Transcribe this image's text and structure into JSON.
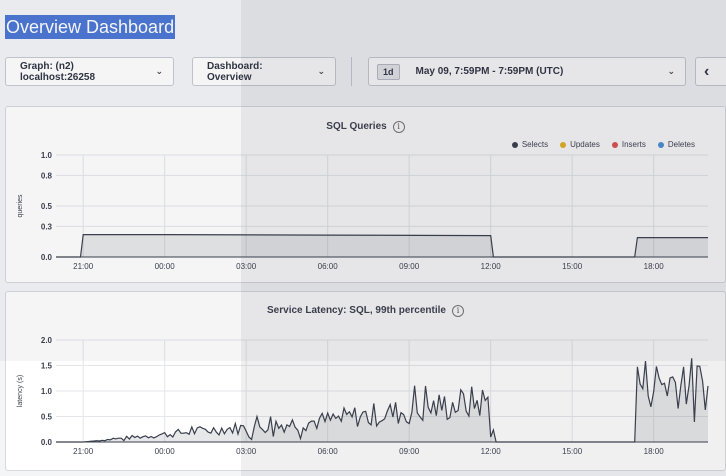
{
  "page": {
    "title": "Overview Dashboard"
  },
  "toolbar": {
    "graph_label": "Graph: (n2) localhost:26258",
    "dashboard_label": "Dashboard: Overview",
    "time_badge": "1d",
    "time_range": "May 09, 7:59PM - 7:59PM (UTC)",
    "prev_icon": "chevron-left-icon"
  },
  "charts": {
    "sql_queries": {
      "title": "SQL Queries",
      "ylabel": "queries",
      "yticks": [
        "1.0",
        "0.8",
        "0.5",
        "0.3",
        "0.0"
      ],
      "xticks": [
        "21:00",
        "00:00",
        "03:00",
        "06:00",
        "09:00",
        "12:00",
        "15:00",
        "18:00"
      ],
      "legend": [
        {
          "name": "Selects",
          "color": "#3a3f4d"
        },
        {
          "name": "Updates",
          "color": "#e6b422"
        },
        {
          "name": "Inserts",
          "color": "#e05252"
        },
        {
          "name": "Deletes",
          "color": "#4a90d9"
        }
      ]
    },
    "service_latency": {
      "title": "Service Latency: SQL, 99th percentile",
      "ylabel": "latency (s)",
      "yticks": [
        "2.0",
        "1.5",
        "1.0",
        "0.5",
        "0.0"
      ],
      "xticks": [
        "21:00",
        "00:00",
        "03:00",
        "06:00",
        "09:00",
        "12:00",
        "15:00",
        "18:00"
      ]
    }
  },
  "chart_data": [
    {
      "type": "area",
      "title": "SQL Queries",
      "ylabel": "queries",
      "ylim": [
        0,
        1.0
      ],
      "x_ticks": [
        "21:00",
        "00:00",
        "03:00",
        "06:00",
        "09:00",
        "12:00",
        "15:00",
        "18:00"
      ],
      "series": [
        {
          "name": "Selects",
          "x": [
            20.0,
            20.9,
            21.0,
            24.0,
            30.0,
            36.0,
            12.1,
            12.3,
            17.3,
            17.4,
            17.6,
            20.0
          ],
          "x_note_hours": "time of day",
          "points_hours": [
            0,
            0.9,
            1.0,
            4.0,
            10.0,
            16.0,
            16.1,
            16.3,
            21.3,
            21.4,
            21.6,
            24.0
          ],
          "values": [
            0,
            0,
            0.22,
            0.22,
            0.215,
            0.21,
            0.0,
            0.0,
            0.0,
            0.19,
            0.19,
            0.19
          ]
        },
        {
          "name": "Updates",
          "values": []
        },
        {
          "name": "Inserts",
          "values": []
        },
        {
          "name": "Deletes",
          "values": []
        }
      ]
    },
    {
      "type": "area",
      "title": "Service Latency: SQL, 99th percentile",
      "ylabel": "latency (s)",
      "ylim": [
        0,
        2.0
      ],
      "x_ticks": [
        "21:00",
        "00:00",
        "03:00",
        "06:00",
        "09:00",
        "12:00",
        "15:00",
        "18:00"
      ],
      "series": [
        {
          "name": "latency",
          "points_hours": [
            0,
            1.0,
            2.0,
            3.0,
            4.0,
            5.0,
            6.0,
            7.0,
            8.0,
            9.0,
            10.0,
            11.0,
            12.0,
            13.0,
            14.0,
            15.0,
            15.9,
            16.2,
            21.3,
            21.4,
            22.0,
            23.0,
            24.0
          ],
          "values": [
            0.0,
            0.0,
            0.05,
            0.1,
            0.15,
            0.2,
            0.25,
            0.28,
            0.32,
            0.38,
            0.42,
            0.5,
            0.55,
            0.6,
            0.68,
            0.75,
            0.8,
            0.0,
            0.0,
            1.2,
            1.15,
            1.2,
            1.1
          ]
        }
      ]
    }
  ]
}
